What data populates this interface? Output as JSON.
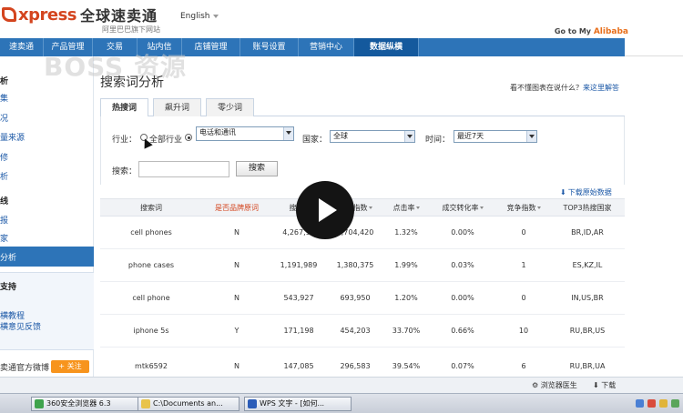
{
  "header": {
    "logo_express": "xpress",
    "logo_cn": "全球速卖通",
    "logo_sub": "阿里巴巴旗下网站",
    "language": "English",
    "goto_prefix": "Go to My",
    "goto_brand": "Alibaba"
  },
  "nav": [
    {
      "label": "速卖通",
      "active": false
    },
    {
      "label": "产品管理",
      "active": false
    },
    {
      "label": "交易",
      "active": false
    },
    {
      "label": "站内信",
      "active": false
    },
    {
      "label": "店铺管理",
      "active": false
    },
    {
      "label": "账号设置",
      "active": false
    },
    {
      "label": "营销中心",
      "active": false
    },
    {
      "label": "数据纵横",
      "active": true
    }
  ],
  "watermark": "BOSS 资源",
  "sidebar": {
    "items": [
      {
        "label": "析",
        "kind": "head"
      },
      {
        "label": "集",
        "kind": "link"
      },
      {
        "label": "况",
        "kind": "link"
      },
      {
        "label": "量来源",
        "kind": "link"
      },
      {
        "label": "修",
        "kind": "link"
      },
      {
        "label": "析",
        "kind": "link"
      },
      {
        "label": "线",
        "kind": "head"
      },
      {
        "label": "报",
        "kind": "link"
      },
      {
        "label": "家",
        "kind": "link"
      }
    ],
    "active_item": "分析",
    "box_title": "支持",
    "box_links": [
      "横教程",
      "横意见反馈"
    ],
    "weibo": "卖通官方微博",
    "follow_button": "+ 关注"
  },
  "main": {
    "title": "搜索词分析",
    "help_text": "看不懂图表在说什么？",
    "help_link": "来这里解答",
    "tabs": [
      {
        "label": "热搜词",
        "active": true
      },
      {
        "label": "飙升词",
        "active": false
      },
      {
        "label": "零少词",
        "active": false
      }
    ],
    "filters": {
      "industry_label": "行业：",
      "radio_all": "全部行业",
      "radio_all_selected": false,
      "radio_specific_selected": true,
      "industry_value": "电话和通讯",
      "country_label": "国家：",
      "country_value": "全球",
      "time_label": "时间：",
      "time_value": "最近7天",
      "search_label": "搜索：",
      "search_value": "",
      "search_button": "搜索"
    },
    "download_link": "下载原始数据",
    "table": {
      "columns": [
        "搜索词",
        "是否品牌原词",
        "搜索",
        "搜索指数",
        "点击率",
        "成交转化率",
        "竞争指数",
        "TOP3热搜国家"
      ],
      "rows": [
        {
          "term": "cell phones",
          "brand": "N",
          "search": "4,267,90",
          "index": "4,704,420",
          "ctr": "1.32%",
          "conv": "0.00%",
          "comp": "0",
          "top3": "BR,ID,AR"
        },
        {
          "term": "phone cases",
          "brand": "N",
          "search": "1,191,989",
          "index": "1,380,375",
          "ctr": "1.99%",
          "conv": "0.03%",
          "comp": "1",
          "top3": "ES,KZ,IL"
        },
        {
          "term": "cell phone",
          "brand": "N",
          "search": "543,927",
          "index": "693,950",
          "ctr": "1.20%",
          "conv": "0.00%",
          "comp": "0",
          "top3": "IN,US,BR"
        },
        {
          "term": "iphone 5s",
          "brand": "Y",
          "search": "171,198",
          "index": "454,203",
          "ctr": "33.70%",
          "conv": "0.66%",
          "comp": "10",
          "top3": "RU,BR,US"
        },
        {
          "term": "mtk6592",
          "brand": "N",
          "search": "147,085",
          "index": "296,583",
          "ctr": "39.54%",
          "conv": "0.07%",
          "comp": "6",
          "top3": "RU,BR,UA"
        }
      ]
    }
  },
  "statusbar": {
    "doctor": "浏览器医生",
    "download": "下载"
  },
  "taskbar": {
    "buttons": [
      "360安全浏览器 6.3",
      "C:\\Documents an...",
      "WPS 文字 - [如何..."
    ]
  }
}
